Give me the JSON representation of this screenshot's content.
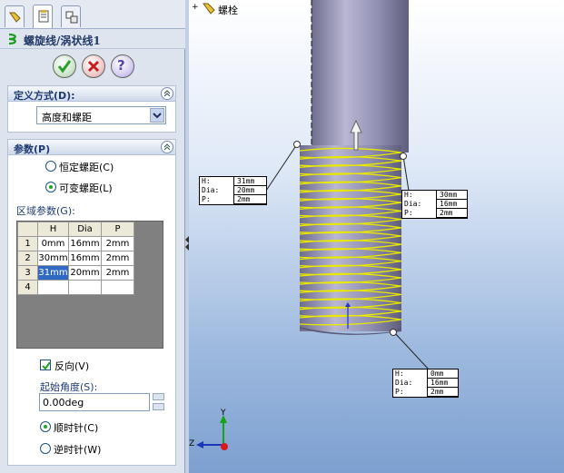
{
  "tree": {
    "part_label": "螺栓",
    "expand": "+"
  },
  "feature": {
    "title": "螺旋线/涡状线1"
  },
  "buttons": {
    "ok": "ok",
    "cancel": "cancel",
    "help": "?"
  },
  "definition": {
    "header": "定义方式(D):",
    "selected": "高度和螺距"
  },
  "params": {
    "header": "参数(P)",
    "radio_constant": "恒定螺距(C)",
    "radio_variable": "可变螺距(L)",
    "region_label": "区域参数(G):",
    "columns": [
      "H",
      "Dia",
      "P"
    ],
    "rows": [
      {
        "idx": "1",
        "h": "0mm",
        "dia": "16mm",
        "p": "2mm"
      },
      {
        "idx": "2",
        "h": "30mm",
        "dia": "16mm",
        "p": "2mm"
      },
      {
        "idx": "3",
        "h": "31mm",
        "dia": "20mm",
        "p": "2mm"
      },
      {
        "idx": "4",
        "h": "",
        "dia": "",
        "p": ""
      }
    ],
    "reverse_label": "反向(V)",
    "start_angle_label": "起始角度(S):",
    "start_angle_value": "0.00deg",
    "cw_label": "顺时针(C)",
    "ccw_label": "逆时针(W)"
  },
  "callouts": [
    {
      "h": "31mm",
      "dia": "20mm",
      "p": "2mm"
    },
    {
      "h": "30mm",
      "dia": "16mm",
      "p": "2mm"
    },
    {
      "h": "0mm",
      "dia": "16mm",
      "p": "2mm"
    }
  ],
  "callout_keys": {
    "h": "H:",
    "dia": "Dia:",
    "p": "P:"
  },
  "axes": {
    "y": "Y",
    "z": "Z"
  },
  "colors": {
    "helix": "#e8e800",
    "ok_green": "#2e9e2e",
    "cancel_red": "#c81e1e",
    "help_purple": "#5a3fae",
    "bolt": "#8e8cae"
  }
}
